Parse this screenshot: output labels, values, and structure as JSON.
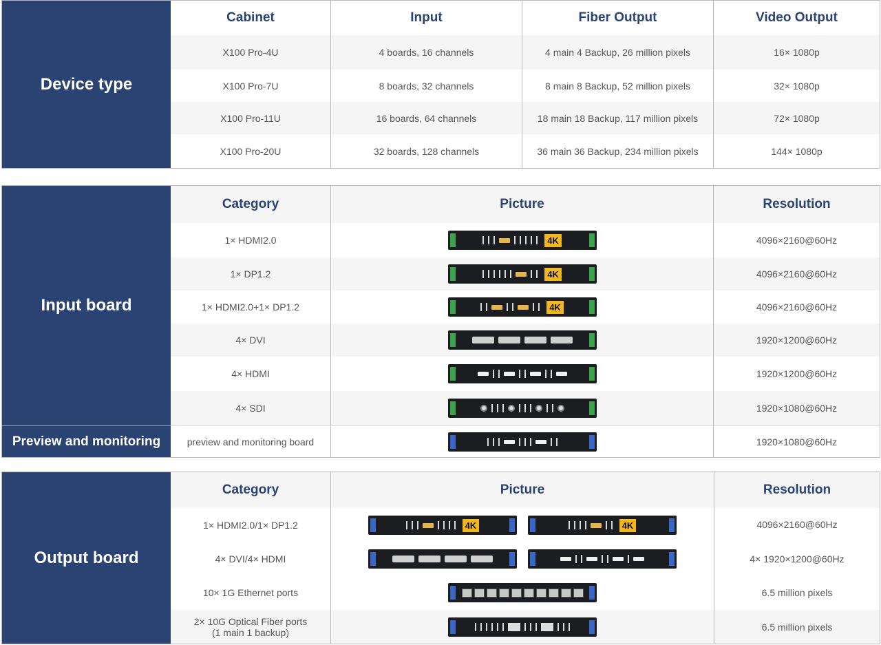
{
  "device": {
    "title": "Device type",
    "headers": [
      "Cabinet",
      "Input",
      "Fiber Output",
      "Video Output"
    ],
    "rows": [
      [
        "X100 Pro-4U",
        "4 boards, 16 channels",
        "4 main 4 Backup, 26 million pixels",
        "16× 1080p"
      ],
      [
        "X100 Pro-7U",
        "8 boards, 32 channels",
        "8 main 8 Backup, 52 million pixels",
        "32× 1080p"
      ],
      [
        "X100 Pro-11U",
        "16 boards, 64 channels",
        "18 main 18 Backup, 117 million pixels",
        "72× 1080p"
      ],
      [
        "X100 Pro-20U",
        "32 boards, 128 channels",
        "36 main 36 Backup, 234 million pixels",
        "144× 1080p"
      ]
    ]
  },
  "input": {
    "title": "Input board",
    "preview_title": "Preview and monitoring",
    "headers": [
      "Category",
      "Picture",
      "Resolution"
    ],
    "rows": [
      {
        "category": "1× HDMI2.0",
        "resolution": "4096×2160@60Hz",
        "badge": "4K"
      },
      {
        "category": "1× DP1.2",
        "resolution": "4096×2160@60Hz",
        "badge": "4K"
      },
      {
        "category": "1× HDMI2.0+1× DP1.2",
        "resolution": "4096×2160@60Hz",
        "badge": "4K"
      },
      {
        "category": "4× DVI",
        "resolution": "1920×1200@60Hz"
      },
      {
        "category": "4× HDMI",
        "resolution": "1920×1200@60Hz"
      },
      {
        "category": "4× SDI",
        "resolution": "1920×1080@60Hz"
      },
      {
        "category": "preview and monitoring board",
        "resolution": "1920×1080@60Hz"
      }
    ]
  },
  "output": {
    "title": "Output board",
    "headers": [
      "Category",
      "Picture",
      "Resolution"
    ],
    "rows": [
      {
        "category": "1× HDMI2.0/1× DP1.2",
        "resolution": "4096×2160@60Hz",
        "badge": "4K"
      },
      {
        "category": "4× DVI/4× HDMI",
        "resolution": "4× 1920×1200@60Hz"
      },
      {
        "category": "10× 1G Ethernet ports",
        "resolution": "6.5 million pixels"
      },
      {
        "category": "2× 10G Optical Fiber ports\n(1 main 1 backup)",
        "resolution": "6.5 million pixels"
      }
    ]
  }
}
